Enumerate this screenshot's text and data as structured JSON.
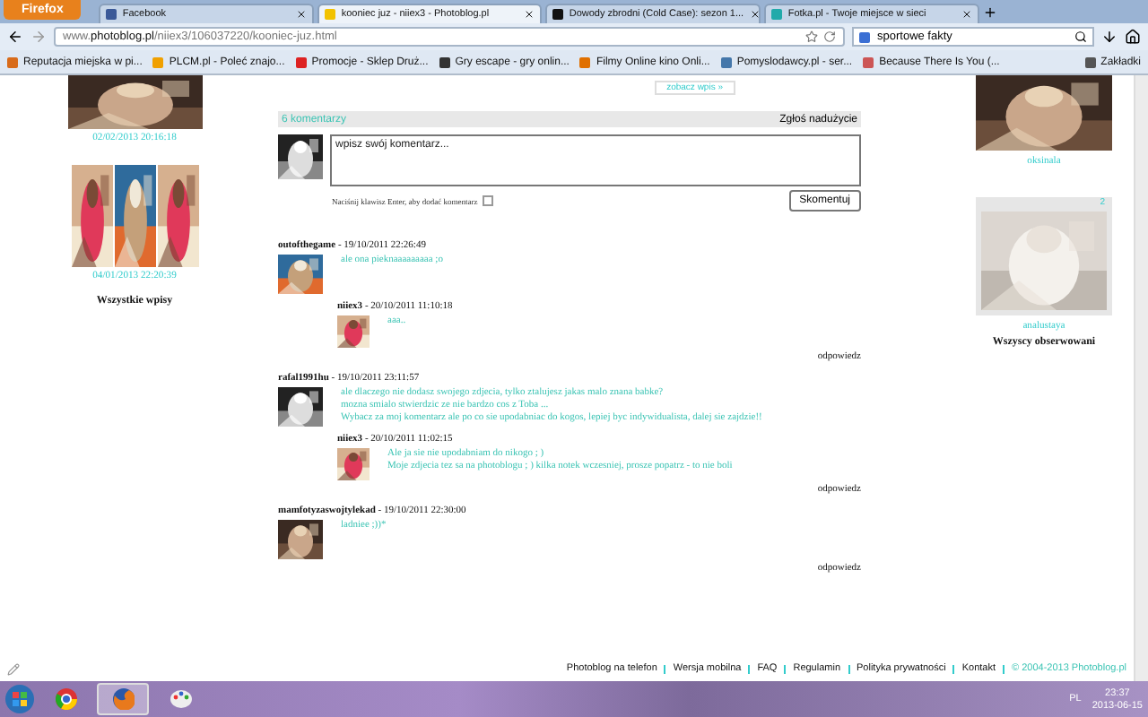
{
  "browser": {
    "menu_button": "Firefox",
    "tabs": [
      {
        "title": "Facebook",
        "selected": false
      },
      {
        "title": "kooniec juz - niiex3 - Photoblog.pl",
        "selected": true
      },
      {
        "title": "Dowody zbrodni (Cold Case): sezon 1...",
        "selected": false
      },
      {
        "title": "Fotka.pl - Twoje miejsce w sieci",
        "selected": false
      }
    ],
    "url": "www.**photoblog.pl**/niiex3/106037220/kooniec-juz.html",
    "search": "sportowe fakty",
    "bookmarks": [
      "Reputacja miejska w pi...",
      "PLCM.pl - Poleć znajo...",
      "Promocje - Sklep Druż...",
      "Gry escape - gry onlin...",
      "Filmy Online kino Onli...",
      "Pomyslodawcy.pl - ser...",
      "Because There Is You (..."
    ],
    "bookmarks_folder": "Zakładki"
  },
  "left": {
    "posts": [
      {
        "date": "02/02/2013 20:16:18",
        "kind": "single"
      },
      {
        "date": "04/01/2013 22:20:39",
        "kind": "collage"
      }
    ],
    "all_link": "Wszystkie wpisy"
  },
  "center": {
    "see_link": "zobacz wpis »",
    "count": "6 komentarzy",
    "report": "Zgłoś nadużycie",
    "placeholder": "wpisz swój komentarz...",
    "enter_label": "Naciśnij klawisz Enter, aby dodać komentarz",
    "enter_checked": false,
    "submit": "Skomentuj",
    "comments": [
      {
        "author": "outofthegame",
        "date": " - 19/10/2011 22:26:49",
        "lines": [
          "ale ona pieknaaaaaaaaa ;o"
        ],
        "reply": {
          "author": "niiex3",
          "date": " - 20/10/2011 11:10:18",
          "lines": [
            "aaa.."
          ]
        },
        "reply_link": "odpowiedz"
      },
      {
        "author": "rafal1991hu",
        "date": " - 19/10/2011 23:11:57",
        "lines": [
          "ale dlaczego nie dodasz swojego zdjecia, tylko ztalujesz jakas malo znana babke?",
          "mozna smialo stwierdzic ze nie bardzo cos z Toba ...",
          "Wybacz za moj komentarz ale po co sie upodabniac do kogos, lepiej byc indywidualista, dalej sie zajdzie!!"
        ],
        "reply": {
          "author": "niiex3",
          "date": " - 20/10/2011 11:02:15",
          "lines": [
            "Ale ja sie nie upodabniam do nikogo ; )",
            "Moje zdjecia tez sa na photoblogu ; ) kilka notek wczesniej, prosze popatrz - to nie boli"
          ]
        },
        "reply_link": "odpowiedz"
      },
      {
        "author": "mamfotyzaswojtylekad",
        "date": " - 19/10/2011 22:30:00",
        "lines": [
          "ladniee ;))*"
        ],
        "reply_link": "odpowiedz"
      }
    ]
  },
  "right": {
    "users": [
      {
        "name": "oksinala",
        "kind": "plain"
      },
      {
        "name": "analustaya",
        "kind": "framed",
        "badge": "2"
      }
    ],
    "all_link": "Wszyscy obserwowani"
  },
  "footer": {
    "links": [
      "Photoblog na telefon",
      "Wersja mobilna",
      "FAQ",
      "Regulamin",
      "Polityka prywatności",
      "Kontakt"
    ],
    "copyright": "© 2004-2013 Photoblog.pl"
  },
  "taskbar": {
    "apps": [
      {
        "kind": "chrome",
        "selected": false
      },
      {
        "kind": "firefox",
        "selected": true
      },
      {
        "kind": "paint",
        "selected": false
      }
    ],
    "language": "PL",
    "time": "23:37",
    "date": "2013-06-15"
  }
}
